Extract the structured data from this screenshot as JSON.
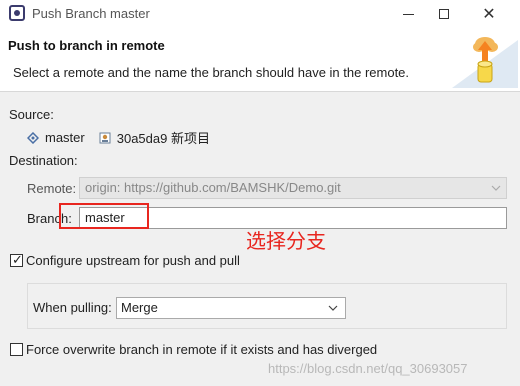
{
  "window": {
    "title": "Push Branch master"
  },
  "header": {
    "title": "Push to branch in remote",
    "description": "Select a remote and the name the branch should have in the remote."
  },
  "source": {
    "label": "Source:",
    "branch": "master",
    "commit": "30a5da9 新项目"
  },
  "destination": {
    "label": "Destination:",
    "remote_label": "Remote:",
    "remote_value": "origin: https://github.com/BAMSHK/Demo.git",
    "branch_label": "Branch:",
    "branch_value": "master"
  },
  "annotation": "选择分支",
  "upstream": {
    "label": "Configure upstream for push and pull",
    "checked": true
  },
  "pulling": {
    "label": "When pulling:",
    "value": "Merge"
  },
  "force": {
    "label": "Force overwrite branch in remote if it exists and has diverged",
    "checked": false
  },
  "watermark": "https://blog.csdn.net/qq_30693057",
  "colors": {
    "annotation_red": "#e8261f"
  }
}
